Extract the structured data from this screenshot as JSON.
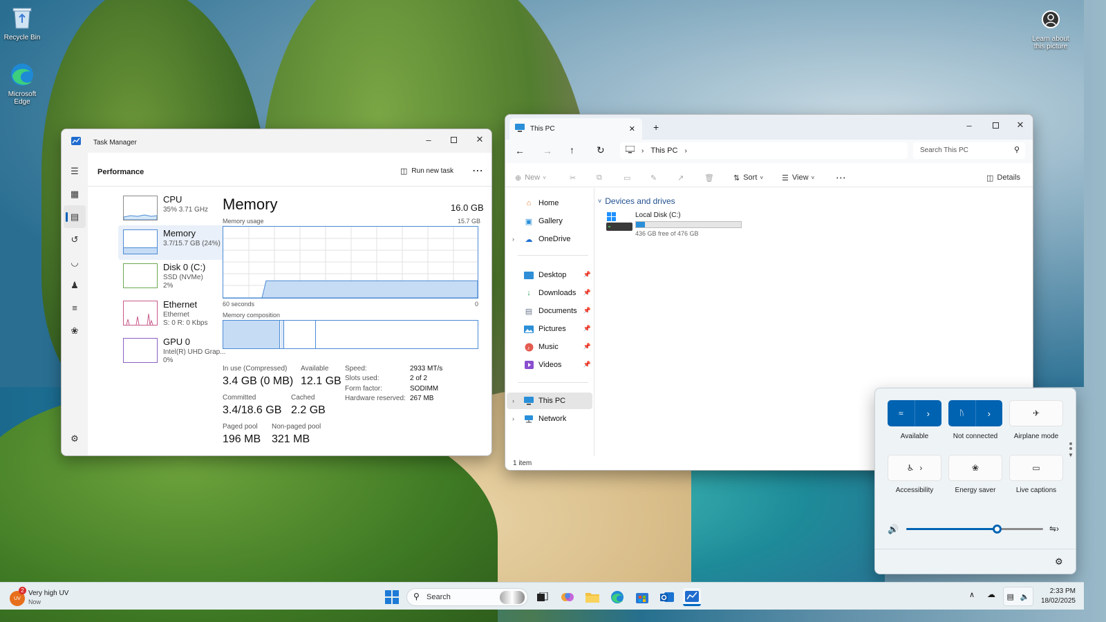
{
  "desktop": {
    "icons": [
      {
        "name": "Recycle Bin"
      },
      {
        "name": "Microsoft Edge",
        "name_line1": "Microsoft",
        "name_line2": "Edge"
      },
      {
        "name_line1": "Learn about",
        "name_line2": "this picture"
      }
    ]
  },
  "task_manager": {
    "title": "Task Manager",
    "section": "Performance",
    "run_new_task": "Run new task",
    "items": [
      {
        "name": "CPU",
        "l1": "35%  3.71 GHz",
        "l2": ""
      },
      {
        "name": "Memory",
        "l1": "3.7/15.7 GB (24%)",
        "l2": ""
      },
      {
        "name": "Disk 0 (C:)",
        "l1": "SSD (NVMe)",
        "l2": "2%"
      },
      {
        "name": "Ethernet",
        "l1": "Ethernet",
        "l2": "S: 0  R: 0 Kbps"
      },
      {
        "name": "GPU 0",
        "l1": "Intel(R) UHD Grap...",
        "l2": "0%"
      }
    ],
    "heading": "Memory",
    "total": "16.0 GB",
    "usage_label": "Memory usage",
    "usage_max": "15.7 GB",
    "axis_left": "60 seconds",
    "axis_right": "0",
    "usage_fraction": 0.24,
    "composition_label": "Memory composition",
    "stats": {
      "in_use_label": "In use (Compressed)",
      "in_use": "3.4 GB (0 MB)",
      "available_label": "Available",
      "available": "12.1 GB",
      "committed_label": "Committed",
      "committed": "3.4/18.6 GB",
      "cached_label": "Cached",
      "cached": "2.2 GB",
      "paged_label": "Paged pool",
      "paged": "196 MB",
      "nonpaged_label": "Non-paged pool",
      "nonpaged": "321 MB"
    },
    "specs": [
      {
        "k": "Speed:",
        "v": "2933 MT/s"
      },
      {
        "k": "Slots used:",
        "v": "2 of 2"
      },
      {
        "k": "Form factor:",
        "v": "SODIMM"
      },
      {
        "k": "Hardware reserved:",
        "v": "267 MB"
      }
    ]
  },
  "explorer": {
    "tab_title": "This PC",
    "breadcrumb": "This PC",
    "search_placeholder": "Search This PC",
    "toolbar": {
      "new": "New",
      "sort": "Sort",
      "view": "View",
      "details": "Details"
    },
    "nav": {
      "home": "Home",
      "gallery": "Gallery",
      "onedrive": "OneDrive",
      "desktop": "Desktop",
      "downloads": "Downloads",
      "documents": "Documents",
      "pictures": "Pictures",
      "music": "Music",
      "videos": "Videos",
      "thispc": "This PC",
      "network": "Network"
    },
    "group_title": "Devices and drives",
    "drive": {
      "name": "Local Disk (C:)",
      "free": "436 GB free of 476 GB",
      "used_fraction": 0.084
    },
    "status": "1 item"
  },
  "quick_settings": {
    "wifi": "Available",
    "bluetooth": "Not connected",
    "airplane": "Airplane mode",
    "accessibility": "Accessibility",
    "energy": "Energy saver",
    "captions": "Live captions",
    "volume_fraction": 0.66
  },
  "taskbar": {
    "weather_title": "Very high UV",
    "weather_sub": "Now",
    "weather_badge": "2",
    "weather_icon_text": "UV",
    "search": "Search",
    "time": "2:33 PM",
    "date": "18/02/2025"
  },
  "colors": {
    "accent": "#005fb8",
    "memory_fill": "#c6dcf5",
    "memory_line": "#4a8ad4"
  }
}
